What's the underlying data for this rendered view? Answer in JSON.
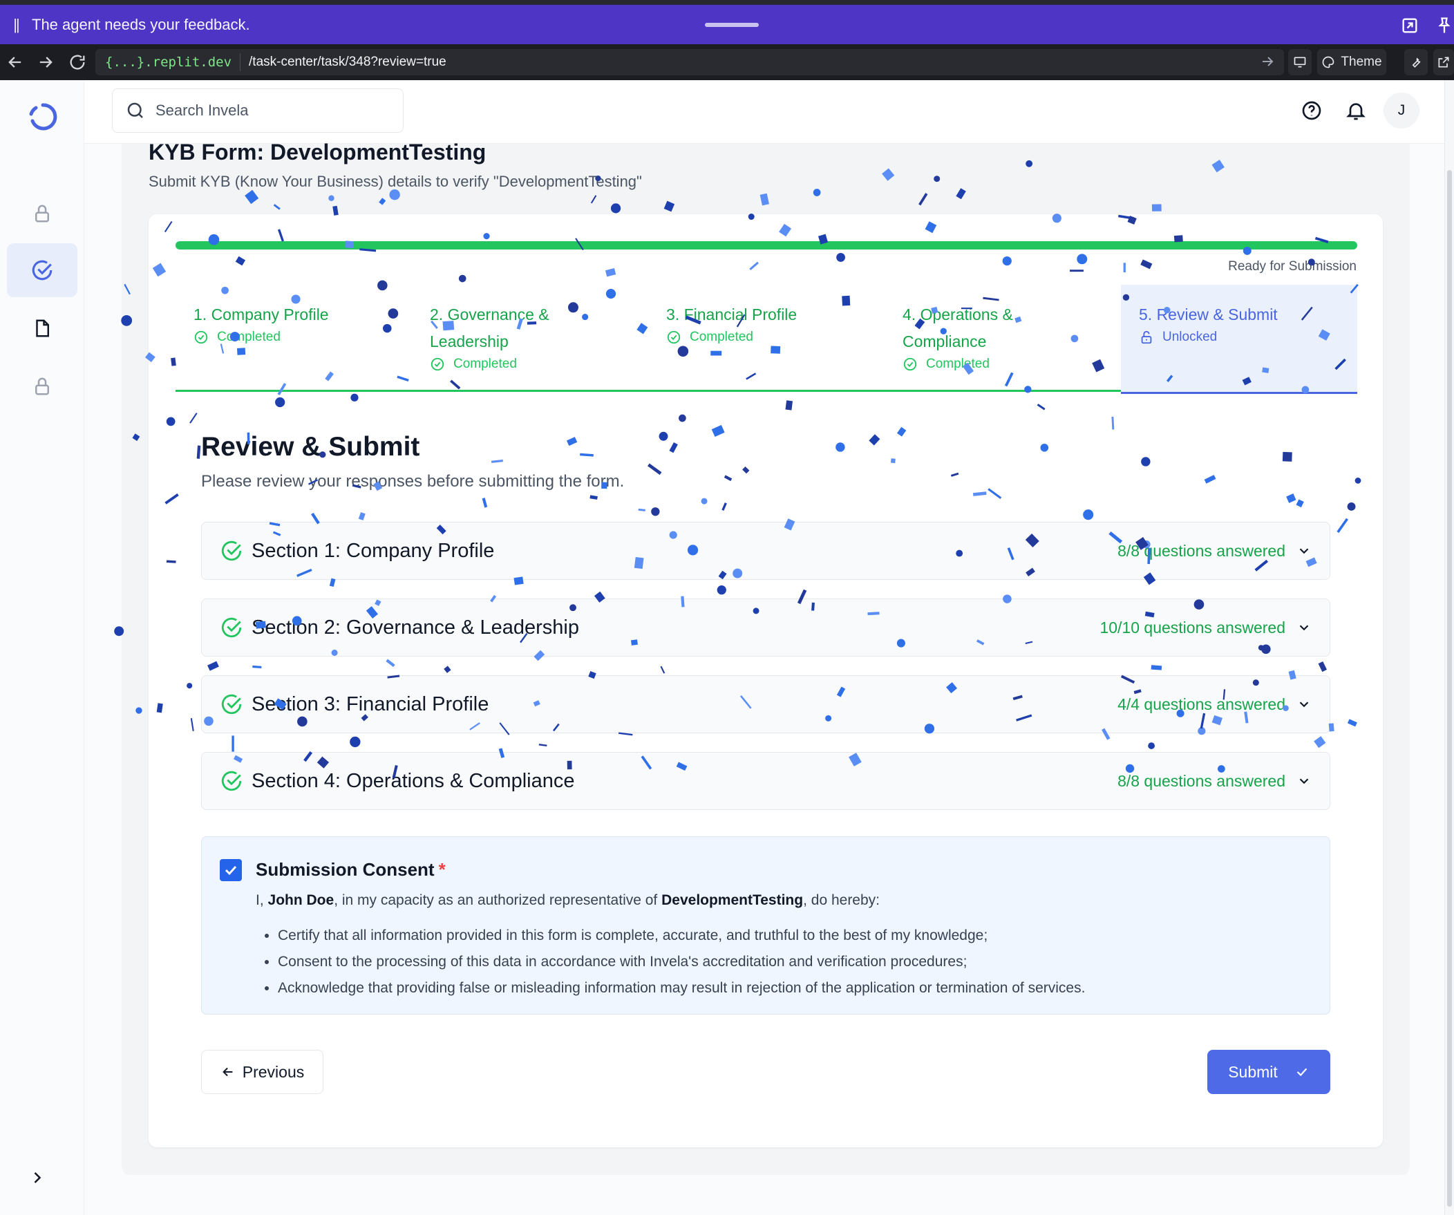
{
  "banner": {
    "message": "The agent needs your feedback."
  },
  "browser": {
    "url_domain": "{...}.replit.dev",
    "url_path": "/task-center/task/348?review=true",
    "theme_label": "Theme"
  },
  "header": {
    "search_placeholder": "Search Invela",
    "avatar_initial": "J"
  },
  "page": {
    "title": "KYB Form: DevelopmentTesting",
    "subtitle": "Submit KYB (Know Your Business) details to verify \"DevelopmentTesting\""
  },
  "progress": {
    "status": "Ready for Submission",
    "value": 1.0
  },
  "steps": [
    {
      "line1": "1. Company Profile",
      "line2": "",
      "status": "Completed"
    },
    {
      "line1": "2. Governance &",
      "line2": "Leadership",
      "status": "Completed"
    },
    {
      "line1": "3. Financial Profile",
      "line2": "",
      "status": "Completed"
    },
    {
      "line1": "4. Operations &",
      "line2": "Compliance",
      "status": "Completed"
    },
    {
      "line1": "5. Review & Submit",
      "line2": "",
      "status": "Unlocked"
    }
  ],
  "review": {
    "title": "Review & Submit",
    "subtitle": "Please review your responses before submitting the form."
  },
  "sections": [
    {
      "title": "Section 1: Company Profile",
      "answered": "8/8 questions answered"
    },
    {
      "title": "Section 2: Governance & Leadership",
      "answered": "10/10 questions answered"
    },
    {
      "title": "Section 3: Financial Profile",
      "answered": "4/4 questions answered"
    },
    {
      "title": "Section 4: Operations & Compliance",
      "answered": "8/8 questions answered"
    }
  ],
  "consent": {
    "title": "Submission Consent",
    "required_mark": "*",
    "checked": true,
    "intro_prefix": "I, ",
    "name": "John Doe",
    "intro_mid": ", in my capacity as an authorized representative of ",
    "company": "DevelopmentTesting",
    "intro_suffix": ", do hereby:",
    "items": [
      "Certify that all information provided in this form is complete, accurate, and truthful to the best of my knowledge;",
      "Consent to the processing of this data in accordance with Invela's accreditation and verification procedures;",
      "Acknowledge that providing false or misleading information may result in rejection of the application or termination of services."
    ]
  },
  "buttons": {
    "previous": "Previous",
    "submit": "Submit"
  },
  "colors": {
    "banner": "#4f35c6",
    "success": "#22c55e",
    "accent": "#4965e0",
    "confetti": [
      "#2f6fe8",
      "#1e3fae",
      "#5b8ef5",
      "#243a9a"
    ]
  }
}
